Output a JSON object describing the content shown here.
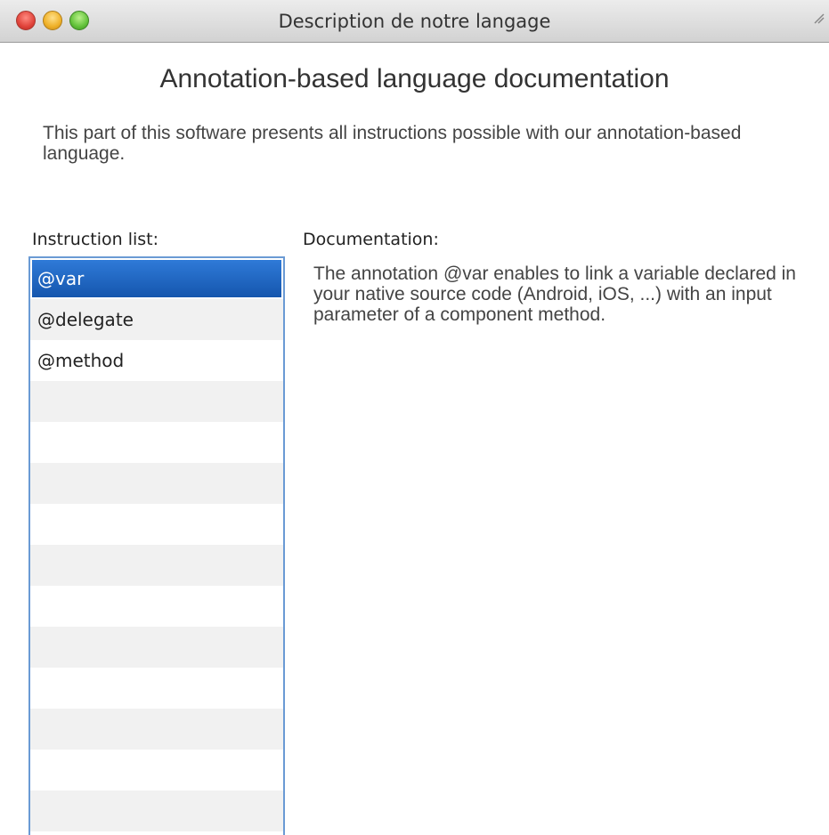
{
  "window": {
    "title": "Description de notre langage",
    "controls": [
      "close-icon",
      "minimize-icon",
      "zoom-icon"
    ],
    "resize_icon": "resize-icon"
  },
  "heading": "Annotation-based language documentation",
  "intro": "This part of this software presents all instructions possible with our annotation-based language.",
  "instruction_list": {
    "label": "Instruction list:",
    "items": [
      {
        "label": "@var",
        "selected": true
      },
      {
        "label": "@delegate",
        "selected": false
      },
      {
        "label": "@method",
        "selected": false
      }
    ],
    "selection_color": "#1f66c4"
  },
  "documentation": {
    "label": "Documentation:",
    "text": "The annotation @var enables to link a variable declared in your native source code (Android, iOS, ...) with an input parameter of a component method."
  }
}
